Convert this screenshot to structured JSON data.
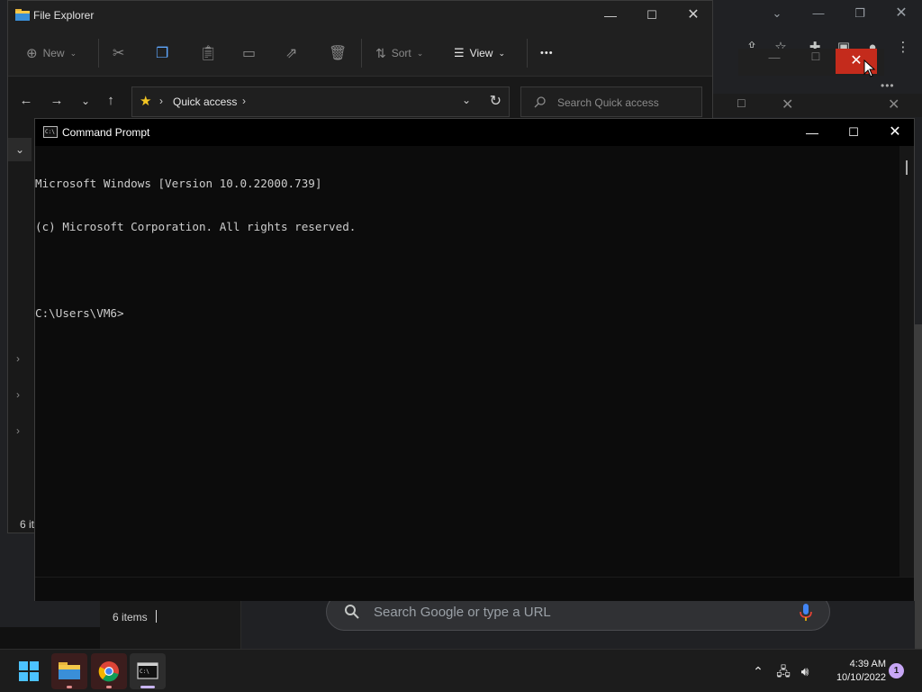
{
  "file_explorer": {
    "title": "File Explorer",
    "toolbar": {
      "new_label": "New",
      "sort_label": "Sort",
      "view_label": "View",
      "more_label": "•••"
    },
    "address": {
      "location": "Quick access"
    },
    "search": {
      "placeholder": "Search Quick access"
    },
    "status_partial": "6 it"
  },
  "command_prompt": {
    "title": "Command Prompt",
    "lines": [
      "Microsoft Windows [Version 10.0.22000.739]",
      "(c) Microsoft Corporation. All rights reserved.",
      "",
      "C:\\Users\\VM6>"
    ]
  },
  "background_explorer": {
    "status": "6 items"
  },
  "chrome": {
    "omnibox_placeholder": "Search Google or type a URL"
  },
  "taskbar": {
    "time": "4:39 AM",
    "date": "10/10/2022",
    "notification_count": "1"
  }
}
